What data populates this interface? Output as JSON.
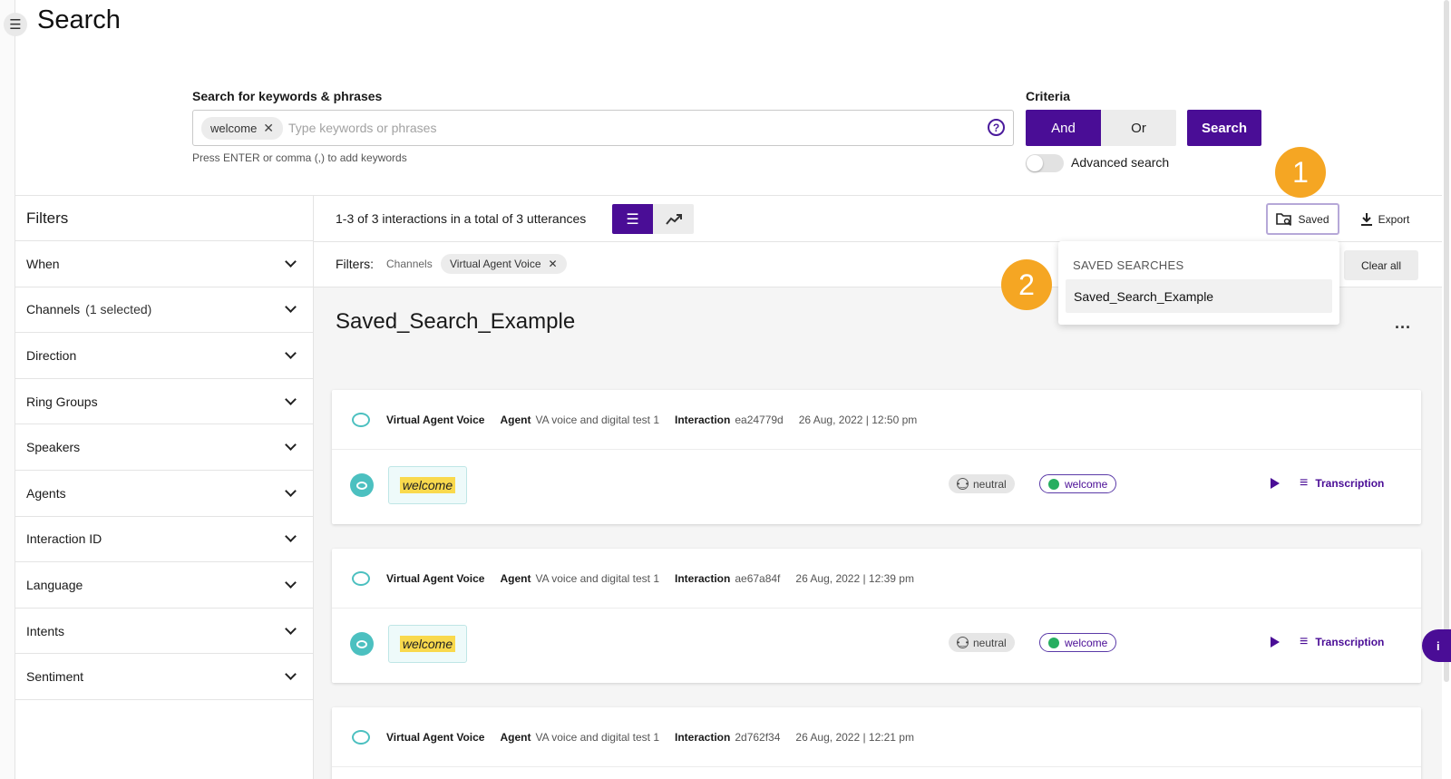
{
  "page": {
    "title": "Search"
  },
  "search": {
    "label": "Search for keywords & phrases",
    "keyword_chip": "welcome",
    "placeholder": "Type keywords or phrases",
    "hint": "Press ENTER or comma (,) to add keywords"
  },
  "criteria": {
    "label": "Criteria",
    "and_label": "And",
    "or_label": "Or",
    "search_button": "Search",
    "advanced_label": "Advanced search"
  },
  "callouts": {
    "one": "1",
    "two": "2"
  },
  "filters": {
    "title": "Filters",
    "items": [
      {
        "label": "When",
        "sub": ""
      },
      {
        "label": "Channels",
        "sub": "(1 selected)"
      },
      {
        "label": "Direction",
        "sub": ""
      },
      {
        "label": "Ring Groups",
        "sub": ""
      },
      {
        "label": "Speakers",
        "sub": ""
      },
      {
        "label": "Agents",
        "sub": ""
      },
      {
        "label": "Interaction ID",
        "sub": ""
      },
      {
        "label": "Language",
        "sub": ""
      },
      {
        "label": "Intents",
        "sub": ""
      },
      {
        "label": "Sentiment",
        "sub": ""
      }
    ]
  },
  "results": {
    "count_text": "1-3 of 3 interactions in a total of 3 utterances",
    "saved_label": "Saved",
    "export_label": "Export",
    "filters_label": "Filters:",
    "filter_channel": "Channels",
    "filter_chip": "Virtual Agent Voice",
    "clear_all": "Clear all",
    "saved_search_name": "Saved_Search_Example",
    "more": "..."
  },
  "saved_dropdown": {
    "header": "SAVED SEARCHES",
    "item": "Saved_Search_Example"
  },
  "cards": [
    {
      "channel": "Virtual Agent Voice",
      "agent_label": "Agent",
      "agent": "VA voice and digital test 1",
      "interaction_label": "Interaction",
      "interaction_id": "ea24779d",
      "datetime": "26 Aug, 2022 | 12:50 pm",
      "utterance": "welcome",
      "sentiment": "neutral",
      "intent": "welcome",
      "transcription_label": "Transcription"
    },
    {
      "channel": "Virtual Agent Voice",
      "agent_label": "Agent",
      "agent": "VA voice and digital test 1",
      "interaction_label": "Interaction",
      "interaction_id": "ae67a84f",
      "datetime": "26 Aug, 2022 | 12:39 pm",
      "utterance": "welcome",
      "sentiment": "neutral",
      "intent": "welcome",
      "transcription_label": "Transcription"
    },
    {
      "channel": "Virtual Agent Voice",
      "agent_label": "Agent",
      "agent": "VA voice and digital test 1",
      "interaction_label": "Interaction",
      "interaction_id": "2d762f34",
      "datetime": "26 Aug, 2022 | 12:21 pm"
    }
  ],
  "info_tab": "i",
  "colors": {
    "brand": "#4a0d96",
    "accent": "#f5a623",
    "teal": "#4cc0c0",
    "positive": "#27ae60"
  }
}
